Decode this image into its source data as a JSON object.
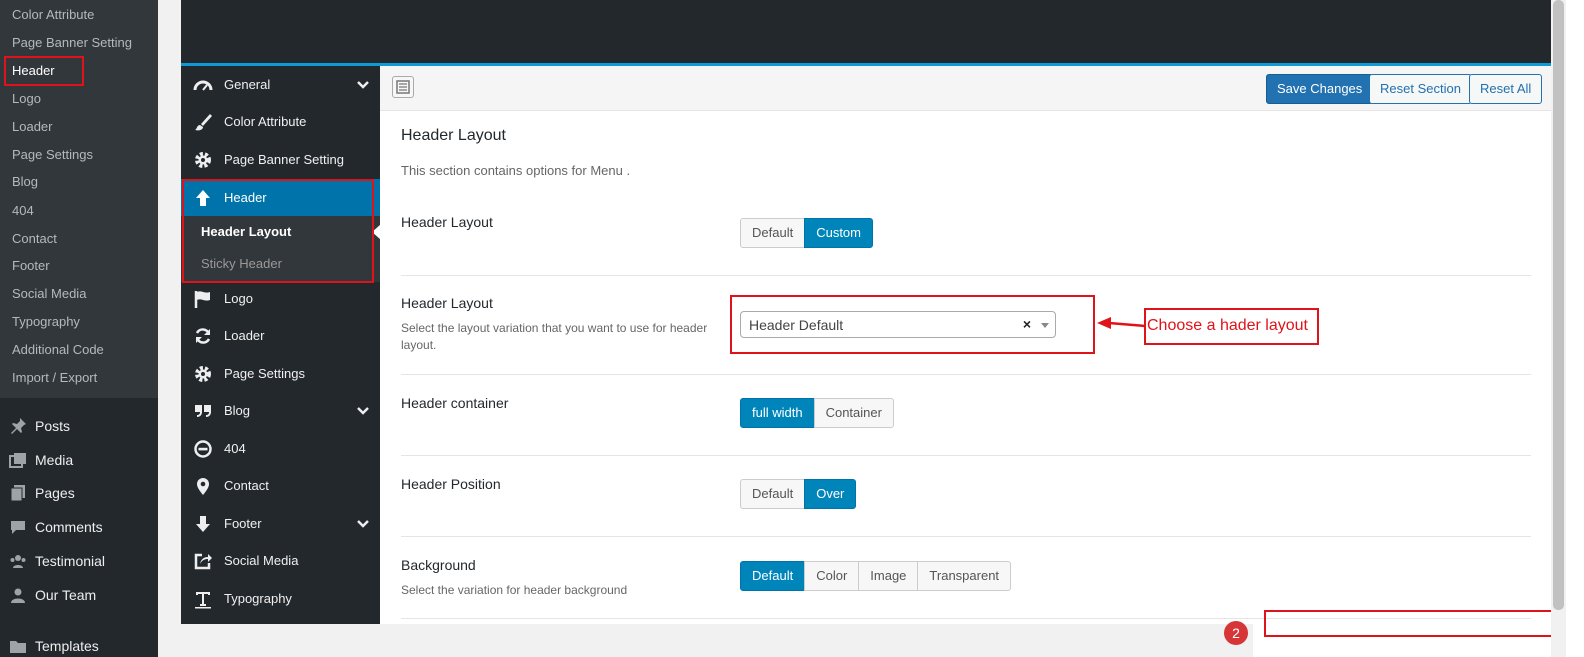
{
  "wp_submenu": [
    {
      "label": "Color Attribute"
    },
    {
      "label": "Page Banner Setting"
    },
    {
      "label": "Header"
    },
    {
      "label": "Logo"
    },
    {
      "label": "Loader"
    },
    {
      "label": "Page Settings"
    },
    {
      "label": "Blog"
    },
    {
      "label": "404"
    },
    {
      "label": "Contact"
    },
    {
      "label": "Footer"
    },
    {
      "label": "Social Media"
    },
    {
      "label": "Typography"
    },
    {
      "label": "Additional Code"
    },
    {
      "label": "Import / Export"
    }
  ],
  "wp_menu": [
    {
      "label": "Posts",
      "icon": "pin-icon"
    },
    {
      "label": "Media",
      "icon": "media-icon"
    },
    {
      "label": "Pages",
      "icon": "pages-icon"
    },
    {
      "label": "Comments",
      "icon": "comments-icon"
    },
    {
      "label": "Testimonial",
      "icon": "testimonial-icon"
    },
    {
      "label": "Our Team",
      "icon": "user-icon"
    },
    {
      "label": "Templates",
      "icon": "templates-icon"
    }
  ],
  "panel_menu": [
    {
      "label": "General",
      "icon": "gauge-icon"
    },
    {
      "label": "Color Attribute",
      "icon": "brush-icon"
    },
    {
      "label": "Page Banner Setting",
      "icon": "gear-icon"
    },
    {
      "label": "Header",
      "icon": "arrow-up-icon"
    },
    {
      "label": "Logo",
      "icon": "flag-icon"
    },
    {
      "label": "Loader",
      "icon": "refresh-icon"
    },
    {
      "label": "Page Settings",
      "icon": "gear-icon"
    },
    {
      "label": "Blog",
      "icon": "quote-icon"
    },
    {
      "label": "404",
      "icon": "minus-circle-icon"
    },
    {
      "label": "Contact",
      "icon": "map-pin-icon"
    },
    {
      "label": "Footer",
      "icon": "arrow-down-icon"
    },
    {
      "label": "Social Media",
      "icon": "share-icon"
    },
    {
      "label": "Typography",
      "icon": "text-icon"
    }
  ],
  "panel_submenu": [
    {
      "label": "Header Layout"
    },
    {
      "label": "Sticky Header"
    }
  ],
  "toolbar": {
    "save_label": "Save Changes",
    "reset_section_label": "Reset Section",
    "reset_all_label": "Reset All"
  },
  "section": {
    "title": "Header Layout",
    "description": "This section contains options for Menu ."
  },
  "fields": {
    "layout_type": {
      "title": "Header Layout",
      "options": [
        "Default",
        "Custom"
      ],
      "selected": "Custom"
    },
    "layout_select": {
      "title": "Header Layout",
      "description": "Select the layout variation that you want to use for header layout.",
      "value": "Header Default",
      "clear": "×"
    },
    "container": {
      "title": "Header container",
      "options": [
        "full width",
        "Container"
      ],
      "selected": "full width"
    },
    "position": {
      "title": "Header Position",
      "options": [
        "Default",
        "Over"
      ],
      "selected": "Over"
    },
    "background": {
      "title": "Background",
      "description": "Select the variation for header background",
      "options": [
        "Default",
        "Color",
        "Image",
        "Transparent"
      ],
      "selected": "Default"
    }
  },
  "annotation": {
    "callout": "Choose a hader layout",
    "color": "#e0131a"
  },
  "badge": {
    "count": "2"
  },
  "colors": {
    "accent": "#0073aa",
    "sidebar": "#23282d",
    "highlight_box": "#e0131a"
  }
}
